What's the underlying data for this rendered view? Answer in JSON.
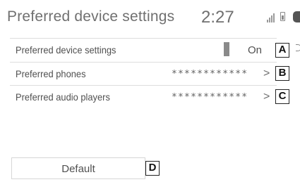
{
  "header": {
    "title": "Preferred device settings",
    "time": "2:27",
    "icons": [
      "signal-icon",
      "battery-icon",
      "bluetooth-icon"
    ]
  },
  "rows": [
    {
      "label": "Preferred device settings",
      "value": "On",
      "control": "toggle"
    },
    {
      "label": "Preferred phones",
      "value": "************",
      "control": "chevron"
    },
    {
      "label": "Preferred audio players",
      "value": "************",
      "control": "chevron"
    }
  ],
  "chevron_glyph": ">",
  "callouts": [
    "A",
    "B",
    "C",
    "D"
  ],
  "default_button": {
    "label": "Default"
  },
  "colors": {
    "background": "#ffffff",
    "text": "#505050",
    "toggle_indicator": "#8a8a8a"
  }
}
